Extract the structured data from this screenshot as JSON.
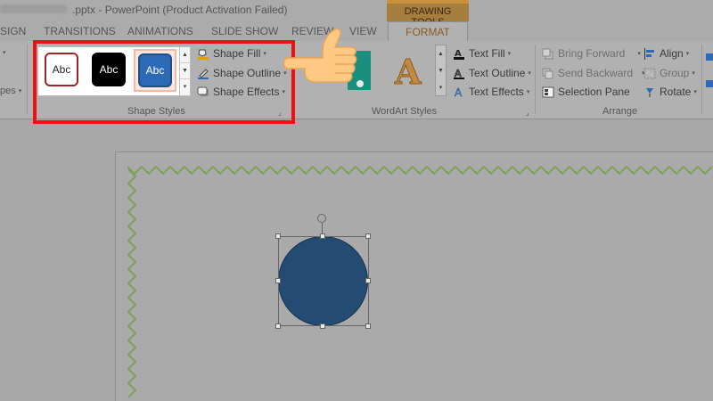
{
  "title_bar": {
    "window_title": "PowerPoint (Product Activation Failed)",
    "file_ext": ".pptx -",
    "contextual_tab_group": "DRAWING TOOLS"
  },
  "tabs": [
    {
      "label": "SIGN"
    },
    {
      "label": "TRANSITIONS"
    },
    {
      "label": "ANIMATIONS"
    },
    {
      "label": "SLIDE SHOW"
    },
    {
      "label": "REVIEW"
    },
    {
      "label": "VIEW"
    },
    {
      "label": "FORMAT"
    }
  ],
  "ribbon": {
    "left_partial": {
      "pes_label": "pes"
    },
    "shape_styles": {
      "group_label": "Shape Styles",
      "presets": [
        {
          "label": "Abc",
          "fill": "#ffffff",
          "border": "#9b2626"
        },
        {
          "label": "Abc",
          "fill": "#000000",
          "border": "#000000"
        },
        {
          "label": "Abc",
          "fill": "#2c6ab5",
          "border": "#1d4f8e"
        }
      ],
      "commands": [
        {
          "label": "Shape Fill",
          "icon": "paint-bucket-icon"
        },
        {
          "label": "Shape Outline",
          "icon": "pencil-outline-icon"
        },
        {
          "label": "Shape Effects",
          "icon": "shape-effects-icon"
        }
      ]
    },
    "wordart_styles": {
      "group_label": "WordArt Styles",
      "sample_letter": "A",
      "commands": [
        {
          "label": "Text Fill",
          "icon": "text-fill-icon"
        },
        {
          "label": "Text Outline",
          "icon": "text-outline-icon"
        },
        {
          "label": "Text Effects",
          "icon": "text-effects-icon"
        }
      ]
    },
    "arrange": {
      "group_label": "Arrange",
      "commands": [
        {
          "label": "Bring Forward",
          "icon": "bring-forward-icon",
          "enabled": false
        },
        {
          "label": "Send Backward",
          "icon": "send-backward-icon",
          "enabled": false
        },
        {
          "label": "Selection Pane",
          "icon": "selection-pane-icon",
          "enabled": true
        },
        {
          "label": "Align",
          "icon": "align-icon",
          "enabled": true
        },
        {
          "label": "Group",
          "icon": "group-icon",
          "enabled": false
        },
        {
          "label": "Rotate",
          "icon": "rotate-icon",
          "enabled": true
        }
      ]
    }
  },
  "colors": {
    "highlight_box": "#ee1111",
    "circle_fill": "#244c73",
    "zigzag": "#7f9f5a",
    "format_tab_text": "#8a5a1c"
  }
}
